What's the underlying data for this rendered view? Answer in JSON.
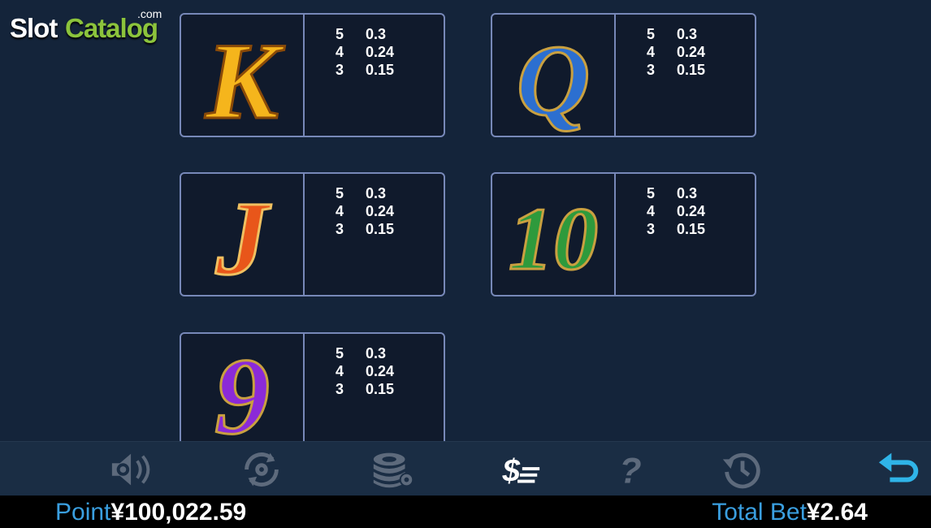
{
  "logo": {
    "part1": "Slot",
    "part2": "Catalog",
    "suffix": ".com"
  },
  "paytable": [
    {
      "symbol": "K",
      "color": "#f5b51c",
      "rows": [
        {
          "count": "5",
          "value": "0.3"
        },
        {
          "count": "4",
          "value": "0.24"
        },
        {
          "count": "3",
          "value": "0.15"
        }
      ]
    },
    {
      "symbol": "Q",
      "color": "#2c6fd0",
      "rows": [
        {
          "count": "5",
          "value": "0.3"
        },
        {
          "count": "4",
          "value": "0.24"
        },
        {
          "count": "3",
          "value": "0.15"
        }
      ]
    },
    {
      "symbol": "J",
      "color": "#e8561a",
      "rows": [
        {
          "count": "5",
          "value": "0.3"
        },
        {
          "count": "4",
          "value": "0.24"
        },
        {
          "count": "3",
          "value": "0.15"
        }
      ]
    },
    {
      "symbol": "10",
      "color": "#2e9a3c",
      "rows": [
        {
          "count": "5",
          "value": "0.3"
        },
        {
          "count": "4",
          "value": "0.24"
        },
        {
          "count": "3",
          "value": "0.15"
        }
      ]
    },
    {
      "symbol": "9",
      "color": "#8b2ad8",
      "rows": [
        {
          "count": "5",
          "value": "0.3"
        },
        {
          "count": "4",
          "value": "0.24"
        },
        {
          "count": "3",
          "value": "0.15"
        }
      ]
    }
  ],
  "toolbar": {
    "icons": [
      "sound-settings-icon",
      "autoplay-settings-icon",
      "bet-chips-icon",
      "paytable-icon",
      "help-icon",
      "history-icon",
      "back-icon"
    ],
    "active_color": "#ffffff",
    "inactive_color": "#5d6a7c",
    "back_color": "#2fb4e8"
  },
  "status": {
    "point_label": "Point",
    "point_value": "¥100,022.59",
    "total_bet_label": "Total Bet",
    "total_bet_value": "¥2.64"
  }
}
